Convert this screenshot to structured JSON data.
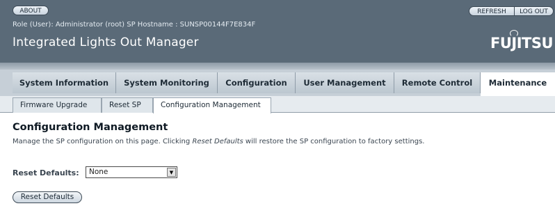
{
  "masthead": {
    "about_label": "ABOUT",
    "refresh_label": "REFRESH",
    "logout_label": "LOG OUT",
    "role_line": "Role (User): Administrator (root)   SP Hostname : SUNSP00144F7E834F",
    "app_title": "Integrated Lights Out Manager",
    "logo_text_pre": "FU",
    "logo_text_i": "J",
    "logo_text_post": "ITSU"
  },
  "main_tabs": [
    {
      "label": "System Information",
      "active": false
    },
    {
      "label": "System Monitoring",
      "active": false
    },
    {
      "label": "Configuration",
      "active": false
    },
    {
      "label": "User Management",
      "active": false
    },
    {
      "label": "Remote Control",
      "active": false
    },
    {
      "label": "Maintenance",
      "active": true
    }
  ],
  "sub_tabs": [
    {
      "label": "Firmware Upgrade",
      "active": false
    },
    {
      "label": "Reset SP",
      "active": false
    },
    {
      "label": "Configuration Management",
      "active": true
    }
  ],
  "content": {
    "title": "Configuration Management",
    "desc_before": "Manage the SP configuration on this page. Clicking ",
    "desc_emph": "Reset Defaults",
    "desc_after": " will restore the SP configuration to factory settings.",
    "reset_defaults_label": "Reset Defaults:",
    "reset_defaults_value": "None",
    "reset_button_label": "Reset Defaults"
  },
  "colors": {
    "masthead": "#5a6a78",
    "tab_bar": "#c6cfd7",
    "active_tab": "#ffffff"
  }
}
